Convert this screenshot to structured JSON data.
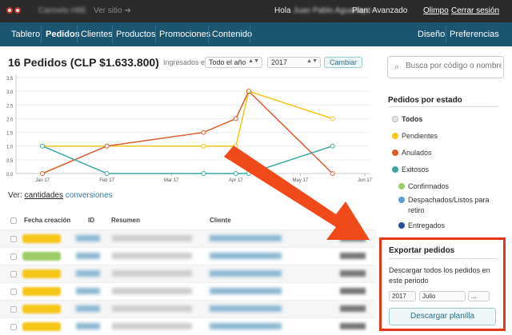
{
  "topbar": {
    "store_name": "Carmelo H8E",
    "ver_sitio": "Ver sitio",
    "hola": "Hola",
    "user_name": "Juan Pablo Aguanaye",
    "plan": "Plan: Avanzado",
    "olimpo": "Olimpo",
    "logout": "Cerrar sesión"
  },
  "nav": {
    "items": [
      "Tablero",
      "Pedidos",
      "Clientes",
      "Productos",
      "Promociones",
      "Contenido"
    ],
    "right": [
      "Diseño",
      "Preferencias"
    ]
  },
  "header": {
    "title": "16 Pedidos (CLP $1.633.800)",
    "ingresados_label": "Ingresados en",
    "period_value": "Todo el año",
    "year_value": "2017",
    "button": "Cambiar"
  },
  "search": {
    "placeholder": "Busca por código o nombre"
  },
  "chart_data": {
    "type": "line",
    "x": [
      "Jan 17",
      "Feb 17",
      "Mar 17",
      "Apr 17",
      "May 17",
      "Jun 17"
    ],
    "yticks": [
      "0.0",
      "0.5",
      "1.0",
      "1.5",
      "2.0",
      "2.5",
      "3.0",
      "3.5"
    ],
    "ylim": [
      0,
      3.5
    ],
    "series": [
      {
        "color": "#f5c518",
        "points": [
          [
            0.0,
            1
          ],
          [
            1.0,
            1
          ],
          [
            2.5,
            1
          ],
          [
            3.0,
            1
          ],
          [
            3.2,
            3
          ],
          [
            4.5,
            2
          ]
        ]
      },
      {
        "color": "#d95d2b",
        "points": [
          [
            0.0,
            0
          ],
          [
            1.0,
            1
          ],
          [
            2.5,
            1.5
          ],
          [
            3.0,
            2
          ],
          [
            3.2,
            3
          ],
          [
            4.5,
            0
          ]
        ]
      },
      {
        "color": "#3aa8a0",
        "points": [
          [
            0.0,
            1
          ],
          [
            1.0,
            0
          ],
          [
            2.5,
            0
          ],
          [
            3.0,
            0
          ],
          [
            3.2,
            0
          ],
          [
            4.5,
            1
          ]
        ]
      }
    ]
  },
  "ver": {
    "label": "Ver:",
    "cantidades": "cantidades",
    "conversiones": "conversiones"
  },
  "table": {
    "headers": [
      "Fecha creación",
      "ID",
      "Resumen",
      "Cliente"
    ],
    "rows": [
      {
        "badge": "y"
      },
      {
        "badge": "g"
      },
      {
        "badge": "y"
      },
      {
        "badge": "y"
      },
      {
        "badge": "y"
      },
      {
        "badge": "y"
      }
    ]
  },
  "sidebar": {
    "estado_heading": "Pedidos por estado",
    "statuses": [
      {
        "label": "Todos",
        "color": "#e6e6e6",
        "bold": true
      },
      {
        "label": "Pendientes",
        "color": "#f5c518"
      },
      {
        "label": "Anulados",
        "color": "#d95d2b"
      },
      {
        "label": "Exitosos",
        "color": "#3aa8a0"
      },
      {
        "label": "Confirmados",
        "color": "#9ccc65"
      },
      {
        "label": "Despachados/Listos para",
        "label2": "retiro",
        "color": "#5b9bd5"
      },
      {
        "label": "Entregados",
        "color": "#2a4f9a"
      }
    ]
  },
  "export": {
    "heading": "Exportar pedidos",
    "description": "Descargar todos los pedidos en este periodo",
    "year": "2017",
    "month": "Julio",
    "extra": "...",
    "button": "Descargar planilla"
  }
}
